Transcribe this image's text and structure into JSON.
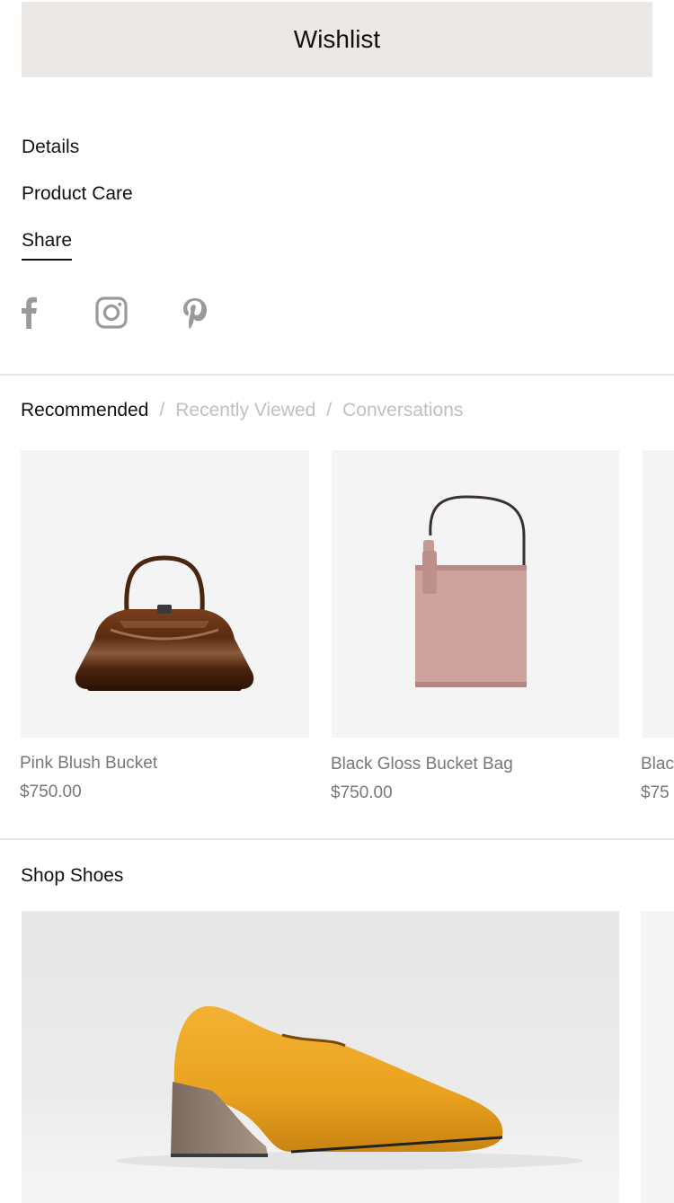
{
  "wishlist": {
    "label": "Wishlist"
  },
  "info_links": {
    "details": "Details",
    "product_care": "Product Care",
    "share": "Share"
  },
  "social": {
    "icons": [
      "facebook-icon",
      "instagram-icon",
      "pinterest-icon"
    ],
    "icon_color": "#9a9a9a"
  },
  "tabs": {
    "items": [
      {
        "label": "Recommended",
        "active": true
      },
      {
        "label": "Recently Viewed",
        "active": false
      },
      {
        "label": "Conversations",
        "active": false
      }
    ],
    "separator": "/"
  },
  "products": [
    {
      "name": "Pink Blush Bucket",
      "price": "$750.00"
    },
    {
      "name": "Black Gloss Bucket Bag",
      "price": "$750.00"
    },
    {
      "name": "Blac",
      "price": "$75"
    }
  ],
  "shop_shoes": {
    "title": "Shop Shoes"
  },
  "colors": {
    "button_bg": "#ebe8e5",
    "text": "#111111",
    "muted": "#777777",
    "tab_inactive": "#c0c0c0",
    "card_bg": "#f4f4f4"
  }
}
